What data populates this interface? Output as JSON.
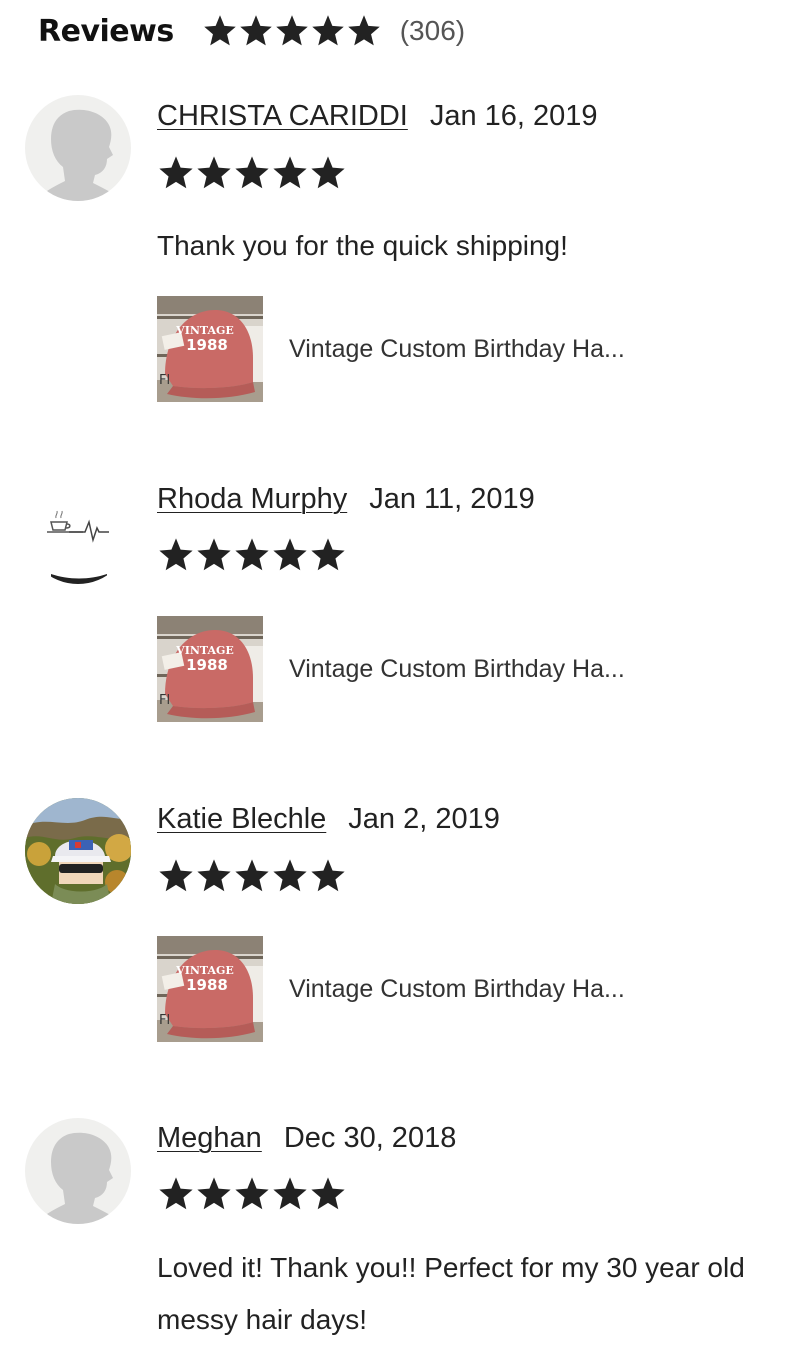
{
  "header": {
    "title": "Reviews",
    "rating_stars": 5,
    "count": "(306)"
  },
  "colors": {
    "star": "#222222",
    "text": "#222222",
    "hat": "#c96a66",
    "avatar_bg": "#f0f0ee",
    "avatar_figure": "#c9c9c9"
  },
  "reviews": [
    {
      "name": "CHRISTA CARIDDI",
      "date": "Jan 16, 2019",
      "stars": 5,
      "text": "Thank you for the quick shipping!",
      "avatar": "default-person-icon",
      "listing_title": "Vintage Custom Birthday Ha..."
    },
    {
      "name": "Rhoda Murphy",
      "date": "Jan 11, 2019",
      "stars": 5,
      "text": "",
      "avatar": "coffee-heartbeat-icon",
      "listing_title": "Vintage Custom Birthday Ha..."
    },
    {
      "name": "Katie Blechle",
      "date": "Jan 2, 2019",
      "stars": 5,
      "text": "",
      "avatar": "user-photo",
      "listing_title": "Vintage Custom Birthday Ha..."
    },
    {
      "name": "Meghan",
      "date": "Dec 30, 2018",
      "stars": 5,
      "text": "Loved it! Thank you!! Perfect for my 30 year old messy hair days!",
      "avatar": "default-person-icon",
      "listing_title": ""
    }
  ]
}
